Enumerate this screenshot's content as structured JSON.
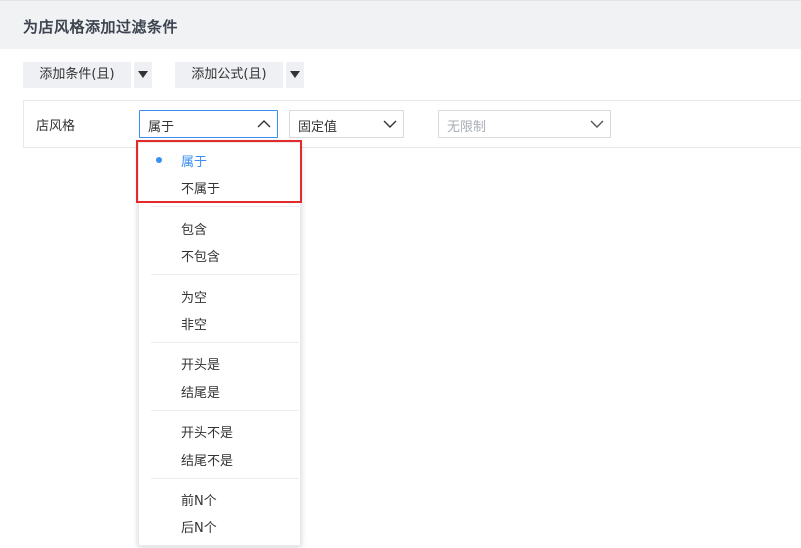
{
  "header": {
    "title": "为店风格添加过滤条件"
  },
  "toolbar": {
    "add_condition_label": "添加条件(且)",
    "add_formula_label": "添加公式(且)"
  },
  "filter": {
    "field": "店风格",
    "operator": "属于",
    "value_type": "固定值",
    "value_placeholder": "无限制"
  },
  "dropdown": {
    "items": [
      {
        "label": "属于",
        "selected": true
      },
      {
        "label": "不属于"
      },
      {
        "label": "包含"
      },
      {
        "label": "不包含"
      },
      {
        "label": "为空"
      },
      {
        "label": "非空"
      },
      {
        "label": "开头是"
      },
      {
        "label": "结尾是"
      },
      {
        "label": "开头不是"
      },
      {
        "label": "结尾不是"
      },
      {
        "label": "前N个"
      },
      {
        "label": "后N个"
      }
    ]
  },
  "colors": {
    "accent": "#3b8ff0",
    "highlight": "#e32b2b",
    "header_bg": "#f1f2f4"
  }
}
